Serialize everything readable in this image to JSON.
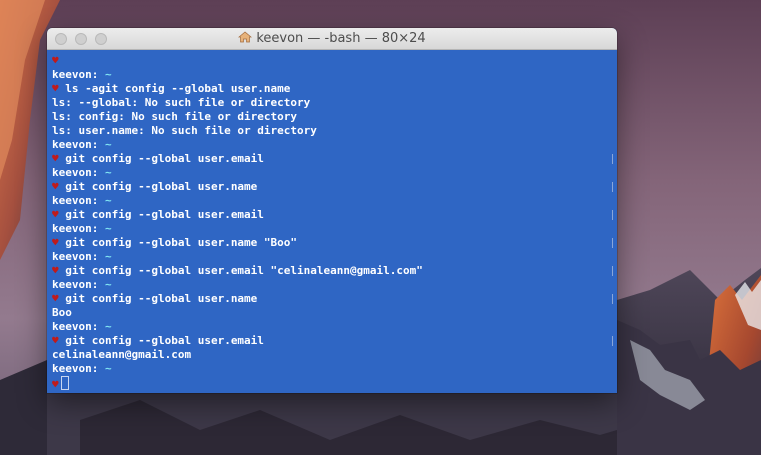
{
  "window": {
    "title": "keevon — -bash — 80×24",
    "icon": "home-icon",
    "background_color": "#2f66c4"
  },
  "terminal": {
    "prompt_symbol": "♥",
    "lines": [
      {
        "kind": "prompt-symbol",
        "text": ""
      },
      {
        "kind": "prompt",
        "user": "keevon:",
        "path": "~"
      },
      {
        "kind": "command",
        "text": "ls -agit config --global user.name"
      },
      {
        "kind": "output",
        "text": "ls: --global: No such file or directory"
      },
      {
        "kind": "output",
        "text": "ls: config: No such file or directory"
      },
      {
        "kind": "output",
        "text": "ls: user.name: No such file or directory"
      },
      {
        "kind": "prompt",
        "user": "keevon:",
        "path": "~"
      },
      {
        "kind": "command",
        "text": "git config --global user.email",
        "mark": true
      },
      {
        "kind": "prompt",
        "user": "keevon:",
        "path": "~"
      },
      {
        "kind": "command",
        "text": "git config --global user.name",
        "mark": true
      },
      {
        "kind": "prompt",
        "user": "keevon:",
        "path": "~"
      },
      {
        "kind": "command",
        "text": "git config --global user.email",
        "mark": true
      },
      {
        "kind": "prompt",
        "user": "keevon:",
        "path": "~"
      },
      {
        "kind": "command",
        "text": "git config --global user.name \"Boo\"",
        "mark": true
      },
      {
        "kind": "prompt",
        "user": "keevon:",
        "path": "~"
      },
      {
        "kind": "command",
        "text": "git config --global user.email \"celinaleann@gmail.com\"",
        "mark": true
      },
      {
        "kind": "prompt",
        "user": "keevon:",
        "path": "~"
      },
      {
        "kind": "command",
        "text": "git config --global user.name",
        "mark": true
      },
      {
        "kind": "output",
        "text": "Boo"
      },
      {
        "kind": "prompt",
        "user": "keevon:",
        "path": "~"
      },
      {
        "kind": "command",
        "text": "git config --global user.email",
        "mark": true
      },
      {
        "kind": "output",
        "text": "celinaleann@gmail.com"
      },
      {
        "kind": "prompt",
        "user": "keevon:",
        "path": "~"
      },
      {
        "kind": "cursor-line",
        "text": ""
      }
    ]
  },
  "colors": {
    "heart": "#c01b1b",
    "tilde": "#7fe3f2",
    "text": "#ffffff"
  }
}
